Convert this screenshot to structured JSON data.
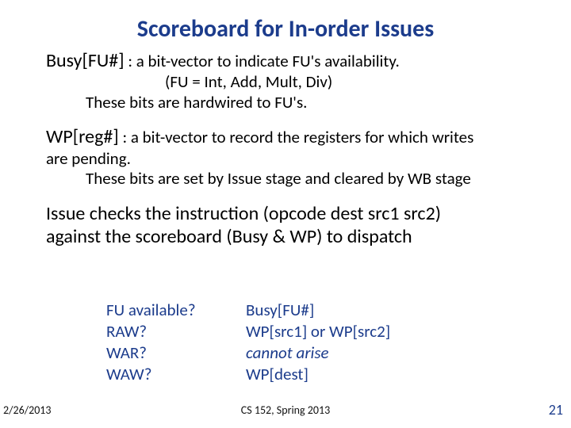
{
  "title": "Scoreboard for In-order Issues",
  "busy": {
    "term": "Busy[FU#]",
    "desc": " : a bit-vector to indicate FU's availability.",
    "fu_list": "(FU = Int, Add, Mult, Div)",
    "hardwired": "These bits are hardwired to FU's."
  },
  "wp": {
    "term": "WP[reg#]",
    "desc": " : a bit-vector to record the registers for which writes",
    "cont": "are pending.",
    "set": "These bits are set by Issue stage and cleared by WB stage"
  },
  "issue": {
    "l1": "Issue checks the instruction (opcode dest src1 src2)",
    "l2": "against the scoreboard (Busy & WP) to dispatch"
  },
  "hazards": {
    "left": [
      "FU available?",
      "RAW?",
      "WAR?",
      "WAW?"
    ],
    "right": [
      "Busy[FU#]",
      "WP[src1] or WP[src2]",
      "cannot arise",
      "WP[dest]"
    ]
  },
  "footer": {
    "date": "2/26/2013",
    "center": "CS 152, Spring 2013",
    "page": "21"
  }
}
